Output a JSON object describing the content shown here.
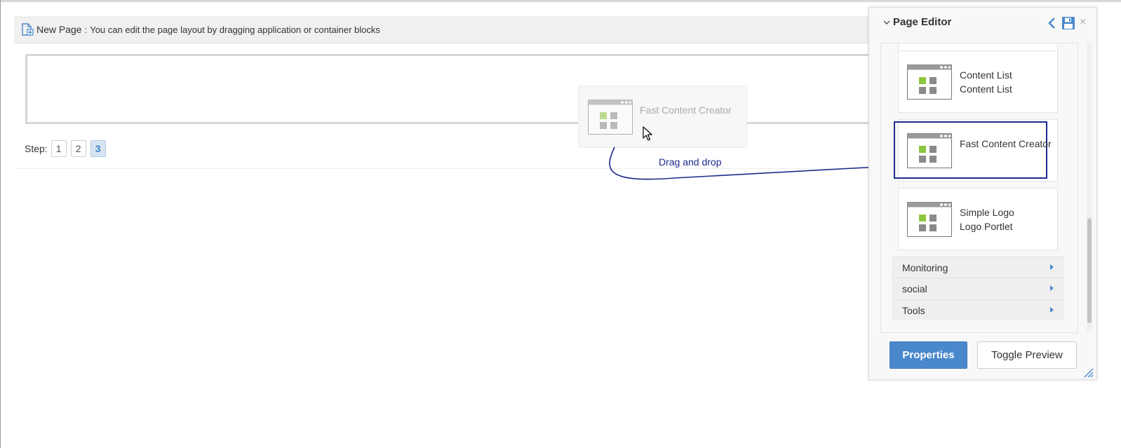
{
  "header": {
    "title": "New Page",
    "separator": ":",
    "description": "You can edit the page layout by dragging application or container blocks"
  },
  "steps": {
    "label": "Step:",
    "items": [
      "1",
      "2",
      "3"
    ],
    "active": "3"
  },
  "drag": {
    "ghost_label": "Fast Content Creator",
    "hint": "Drag and drop"
  },
  "editor": {
    "title": "Page Editor",
    "apps": [
      {
        "name": "Content List",
        "subtitle": "Content List"
      },
      {
        "name": "Fast Content Creator",
        "subtitle": ""
      },
      {
        "name": "Simple Logo",
        "subtitle": "Logo Portlet"
      }
    ],
    "categories": [
      "Monitoring",
      "social",
      "Tools"
    ],
    "buttons": {
      "properties": "Properties",
      "toggle_preview": "Toggle Preview"
    }
  },
  "colors": {
    "accent": "#4a88cc",
    "drag_annotation": "#1c2a8c",
    "app_icon_green": "#8cc63f"
  },
  "icons": {
    "header": "new-page-icon",
    "collapse": "chevron-down-icon",
    "back": "chevron-left-icon",
    "save": "floppy-disk-icon",
    "close": "close-icon",
    "app": "application-window-icon",
    "cursor": "mouse-pointer-icon",
    "resize": "resize-handle-icon"
  }
}
